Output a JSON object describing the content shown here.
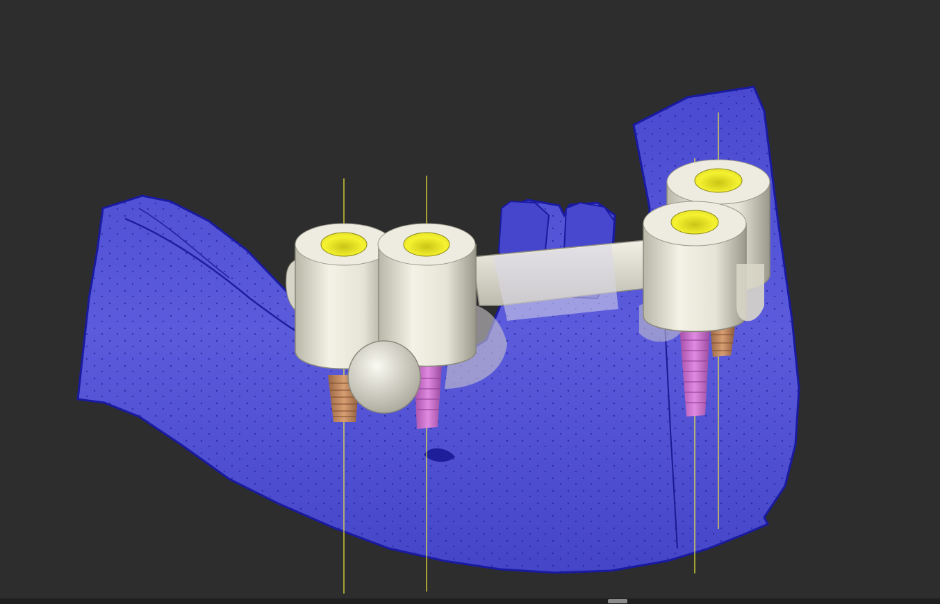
{
  "viewport": {
    "background": "#2d2d2d",
    "model": {
      "jaw_color": "#5a5ad8",
      "jaw_dark": "#1d1da8",
      "sleeve_color": "#e4e2d4",
      "sleeve_hole": "#f3ef2b",
      "implant_bronze": "#c98e63",
      "implant_pink": "#d37ad6",
      "axis_color": "#f3ee3a"
    },
    "implants": [
      {
        "id": "implant-1",
        "type": "bronze"
      },
      {
        "id": "implant-2",
        "type": "pink"
      },
      {
        "id": "implant-3",
        "type": "pink"
      },
      {
        "id": "implant-4",
        "type": "bronze"
      }
    ]
  },
  "scrollbar": {
    "thumb_fraction": 0.66
  }
}
